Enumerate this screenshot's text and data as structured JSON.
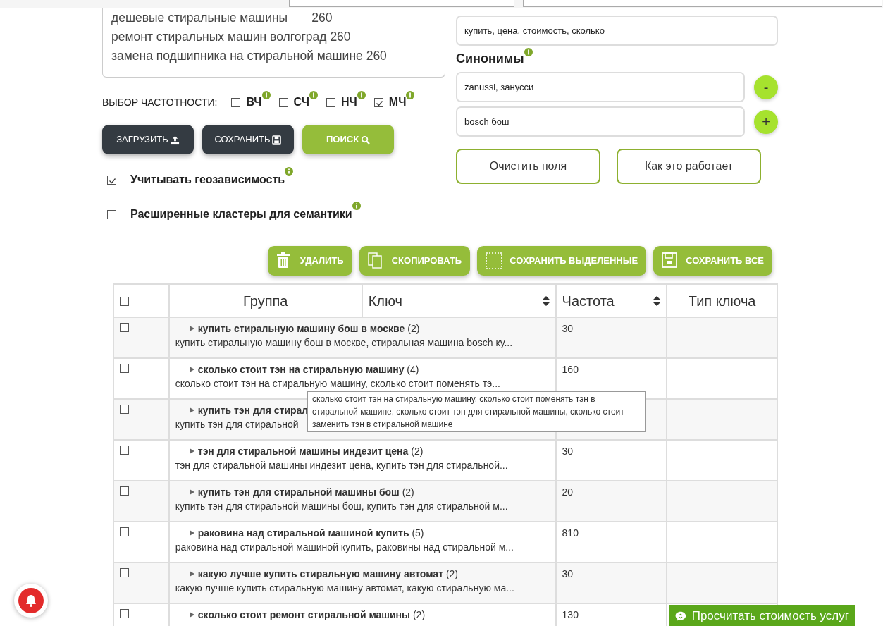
{
  "textarea": {
    "value": "дешевые стиральные машины       260\nремонт стиральных машин волгоград 260\nзамена подшипника на стиральной машине 260"
  },
  "frequency": {
    "label": "ВЫБОР ЧАСТОТНОСТИ:",
    "options": [
      {
        "label": "ВЧ",
        "checked": false
      },
      {
        "label": "СЧ",
        "checked": false
      },
      {
        "label": "НЧ",
        "checked": false
      },
      {
        "label": "МЧ",
        "checked": true
      }
    ]
  },
  "action_buttons": [
    {
      "label": "ЗАГРУЗИТЬ",
      "kind": "upload"
    },
    {
      "label": "СОХРАНИТЬ",
      "kind": "save"
    },
    {
      "label": "ПОИСК",
      "kind": "search"
    }
  ],
  "options": [
    {
      "label": "Учитывать геозависимость",
      "checked": true
    },
    {
      "label": "Расширенные кластеры для семантики",
      "checked": false
    }
  ],
  "stop_words_field": {
    "value": "купить, цена, стоимость, сколько"
  },
  "synonyms": {
    "title": "Синонимы",
    "fields": [
      {
        "value": "zanussi, занусси",
        "button": "-"
      },
      {
        "value": "bosch бош",
        "button": "+"
      }
    ]
  },
  "form_buttons": [
    "Очистить поля",
    "Как это работает"
  ],
  "table_toolbar": [
    {
      "label": "УДАЛИТЬ",
      "kind": "delete"
    },
    {
      "label": "СКОПИРОВАТЬ",
      "kind": "copy"
    },
    {
      "label": "СОХРАНИТЬ ВЫДЕЛЕННЫЕ",
      "kind": "select"
    },
    {
      "label": "СОХРАНИТЬ ВСЕ",
      "kind": "save"
    }
  ],
  "table": {
    "header_checked": false,
    "columns": [
      {
        "label": "Группа",
        "sortable": false
      },
      {
        "label": "Ключ",
        "sortable": true
      },
      {
        "label": "Частота",
        "sortable": true
      },
      {
        "label": "Тип ключа",
        "sortable": false
      }
    ],
    "rows": [
      {
        "checked": false,
        "group": "**купить стиральную машину бош в москве** (2)",
        "keys": "купить стиральную машину бош в москве, стиральная машина bosch ку...",
        "frequency": "30"
      },
      {
        "checked": false,
        "group": "**сколько стоит тэн на стиральную машину** (4)",
        "keys": "сколько стоит тэн на стиральную машину, сколько стоит поменять тэ...",
        "frequency": "160"
      },
      {
        "checked": false,
        "group": "**купить тэн для стирал**",
        "keys": "купить тэн для стиральной"
      },
      {
        "checked": false,
        "group": "**тэн для стиральной машины индезит цена** (2)",
        "keys": "тэн для стиральной машины индезит цена, купить тэн для стиральной...",
        "frequency": "30"
      },
      {
        "checked": false,
        "group": "**купить тэн для стиральной машины бош** (2)",
        "keys": "купить тэн для стиральной машины бош, купить тэн для стиральной м...",
        "frequency": "20"
      },
      {
        "checked": false,
        "group": "**раковина над стиральной машиной купить** (5)",
        "keys": "раковина над стиральной машиной купить, раковины над стиральной м...",
        "frequency": "810"
      },
      {
        "checked": false,
        "group": "**какую лучше купить стиральную машину автомат** (2)",
        "keys": "какую лучше купить стиральную машину автомат, какую стиральную ма...",
        "frequency": "30"
      },
      {
        "checked": false,
        "group": "**сколько стоит ремонт стиральной машины** (2)",
        "frequency": "130"
      }
    ]
  },
  "tooltip": {
    "text": "сколько стоит тэн на стиральную машину, сколько стоит поменять тэн в стиральной машине, сколько стоит тэн для стиральной машины, сколько стоит заменить тэн в стиральной машине"
  },
  "widget": {
    "label": "Просчитать стоимость услуг"
  }
}
